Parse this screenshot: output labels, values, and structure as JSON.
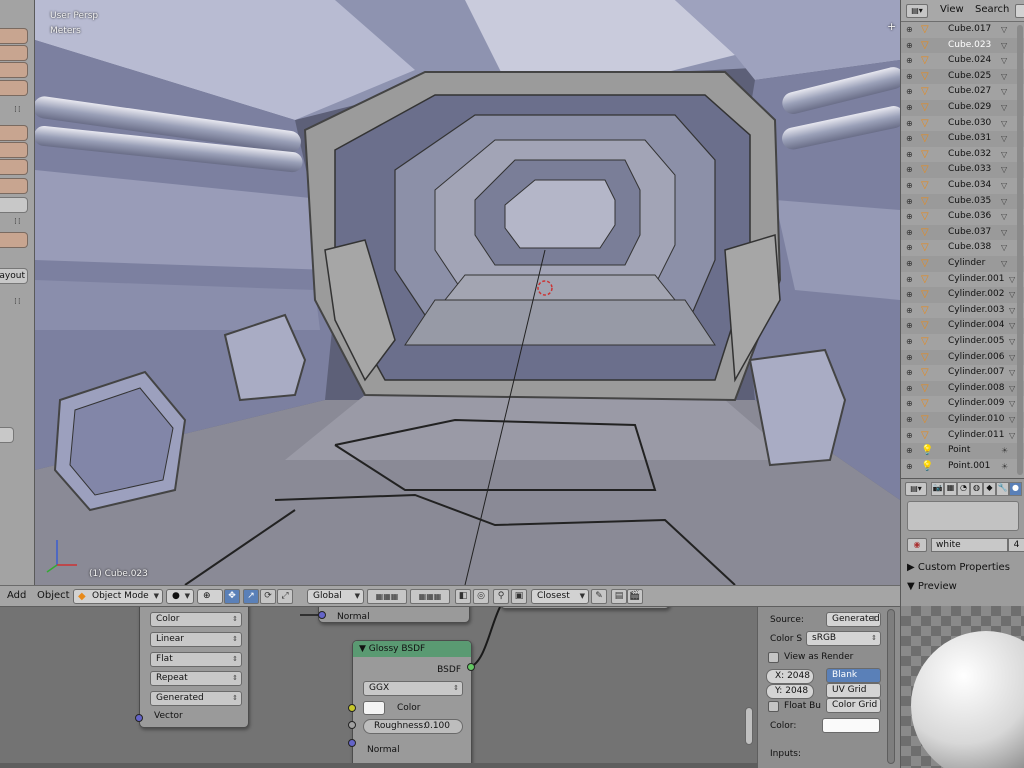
{
  "viewport": {
    "view_name": "User Persp",
    "units": "Meters",
    "active_object": "(1) Cube.023"
  },
  "toolshelf": {
    "layout_label": "Layout"
  },
  "header": {
    "add_menu": "Add",
    "object_menu": "Object",
    "mode": "Object Mode",
    "orientation": "Global",
    "snap_target": "Closest"
  },
  "node_editor": {
    "image_node_fields": [
      "Color",
      "Linear",
      "Flat",
      "Repeat",
      "Generated"
    ],
    "image_node_output": "Vector",
    "top_node_output": "Normal",
    "glossy": {
      "title": "Glossy BSDF",
      "output": "BSDF",
      "distribution": "GGX",
      "color_label": "Color",
      "roughness_label": "Roughness:",
      "roughness_value": "0.100",
      "normal_label": "Normal"
    }
  },
  "image_props": {
    "source_label": "Source:",
    "source_value": "Generated",
    "colorspace_label": "Color S",
    "colorspace_value": "sRGB",
    "view_as_render": "View as Render",
    "width_label": "X:",
    "width_value": "2048",
    "height_label": "Y:",
    "height_value": "2048",
    "float_buffer": "Float Bu",
    "types": [
      "Blank",
      "UV Grid",
      "Color Grid"
    ],
    "color_label": "Color:",
    "inputs_label": "Inputs:"
  },
  "outliner": {
    "view_menu": "View",
    "search_menu": "Search",
    "items": [
      {
        "name": "Cube.017",
        "type": "mesh"
      },
      {
        "name": "Cube.023",
        "type": "mesh",
        "selected": true
      },
      {
        "name": "Cube.024",
        "type": "mesh"
      },
      {
        "name": "Cube.025",
        "type": "mesh"
      },
      {
        "name": "Cube.027",
        "type": "mesh"
      },
      {
        "name": "Cube.029",
        "type": "mesh"
      },
      {
        "name": "Cube.030",
        "type": "mesh"
      },
      {
        "name": "Cube.031",
        "type": "mesh"
      },
      {
        "name": "Cube.032",
        "type": "mesh"
      },
      {
        "name": "Cube.033",
        "type": "mesh"
      },
      {
        "name": "Cube.034",
        "type": "mesh"
      },
      {
        "name": "Cube.035",
        "type": "mesh"
      },
      {
        "name": "Cube.036",
        "type": "mesh"
      },
      {
        "name": "Cube.037",
        "type": "mesh"
      },
      {
        "name": "Cube.038",
        "type": "mesh"
      },
      {
        "name": "Cylinder",
        "type": "mesh"
      },
      {
        "name": "Cylinder.001",
        "type": "mesh"
      },
      {
        "name": "Cylinder.002",
        "type": "mesh"
      },
      {
        "name": "Cylinder.003",
        "type": "mesh"
      },
      {
        "name": "Cylinder.004",
        "type": "mesh"
      },
      {
        "name": "Cylinder.005",
        "type": "mesh"
      },
      {
        "name": "Cylinder.006",
        "type": "mesh"
      },
      {
        "name": "Cylinder.007",
        "type": "mesh"
      },
      {
        "name": "Cylinder.008",
        "type": "mesh"
      },
      {
        "name": "Cylinder.009",
        "type": "mesh"
      },
      {
        "name": "Cylinder.010",
        "type": "mesh"
      },
      {
        "name": "Cylinder.011",
        "type": "mesh"
      },
      {
        "name": "Point",
        "type": "lamp"
      },
      {
        "name": "Point.001",
        "type": "lamp"
      }
    ]
  },
  "properties": {
    "material_name": "white",
    "material_users": "4",
    "custom_properties": "Custom Properties",
    "preview": "Preview"
  },
  "colors": {
    "selection_blue": "#5a80b8",
    "glossy_header": "#5a9a72",
    "outliner_bg": "#a2a2a2",
    "mesh_icon": "#e88a1a"
  }
}
